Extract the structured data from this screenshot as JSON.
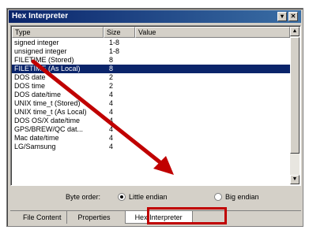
{
  "window": {
    "title": "Hex Interpreter",
    "dropdown_glyph": "▾",
    "close_glyph": "✕"
  },
  "list": {
    "columns": [
      "Type",
      "Size",
      "Value"
    ],
    "rows": [
      {
        "type": "signed integer",
        "size": "1-8",
        "value": ""
      },
      {
        "type": "unsigned integer",
        "size": "1-8",
        "value": ""
      },
      {
        "type": "FILETIME (Stored)",
        "size": "8",
        "value": ""
      },
      {
        "type": "FILETIME (As Local)",
        "size": "8",
        "value": ""
      },
      {
        "type": "DOS date",
        "size": "2",
        "value": ""
      },
      {
        "type": "DOS time",
        "size": "2",
        "value": ""
      },
      {
        "type": "DOS date/time",
        "size": "4",
        "value": ""
      },
      {
        "type": "UNIX time_t (Stored)",
        "size": "4",
        "value": ""
      },
      {
        "type": "UNIX time_t (As Local)",
        "size": "4",
        "value": ""
      },
      {
        "type": "DOS OS/X date/time",
        "size": "4",
        "value": ""
      },
      {
        "type": "GPS/BREW/QC dat...",
        "size": "4",
        "value": ""
      },
      {
        "type": "Mac date/time",
        "size": "4",
        "value": ""
      },
      {
        "type": "LG/Samsung",
        "size": "4",
        "value": ""
      }
    ],
    "selected_index": 3,
    "scroll_up_glyph": "▲",
    "scroll_down_glyph": "▼"
  },
  "byte_order": {
    "label": "Byte order:",
    "little": "Little endian",
    "big": "Big endian",
    "selected": "little"
  },
  "tabs": [
    {
      "label": "File Content"
    },
    {
      "label": "Properties"
    },
    {
      "label": "Hex Interpreter"
    }
  ],
  "colors": {
    "annotation_red": "#c00000",
    "selection_blue": "#0a246a"
  }
}
